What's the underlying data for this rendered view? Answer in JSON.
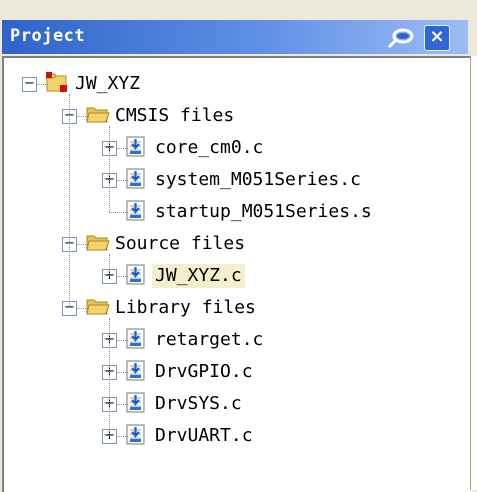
{
  "panel": {
    "title": "Project",
    "pin_icon": "pin-icon",
    "close_icon": "close-icon",
    "close_glyph": "×"
  },
  "tree": {
    "root": {
      "label": "JW_XYZ",
      "icon": "project-icon",
      "expanded": true
    },
    "groups": [
      {
        "label": "CMSIS files",
        "icon": "folder-open-icon",
        "expanded": true,
        "files": [
          {
            "label": "core_cm0.c",
            "icon": "c-file-icon",
            "expandable": true
          },
          {
            "label": "system_M051Series.c",
            "icon": "c-file-icon",
            "expandable": true
          },
          {
            "label": "startup_M051Series.s",
            "icon": "asm-file-icon",
            "expandable": false
          }
        ]
      },
      {
        "label": "Source files",
        "icon": "folder-open-icon",
        "expanded": true,
        "files": [
          {
            "label": "JW_XYZ.c",
            "icon": "c-file-icon",
            "expandable": true,
            "selected": true
          }
        ]
      },
      {
        "label": "Library files",
        "icon": "folder-open-icon",
        "expanded": true,
        "files": [
          {
            "label": "retarget.c",
            "icon": "c-file-icon",
            "expandable": true
          },
          {
            "label": "DrvGPIO.c",
            "icon": "c-file-icon",
            "expandable": true
          },
          {
            "label": "DrvSYS.c",
            "icon": "c-file-icon",
            "expandable": true
          },
          {
            "label": "DrvUART.c",
            "icon": "c-file-icon",
            "expandable": true
          }
        ]
      }
    ],
    "expanded_glyph": "−",
    "collapsed_glyph": "+"
  },
  "colors": {
    "title_gradient_start": "#2f63c8",
    "title_gradient_end": "#9cbcf5",
    "selection": "#f3efcf",
    "folder": "#f3d468"
  }
}
